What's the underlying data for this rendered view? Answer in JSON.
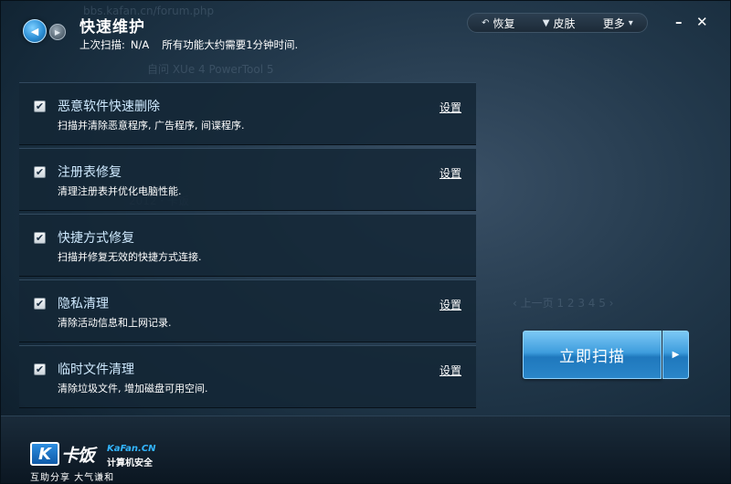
{
  "header": {
    "title": "快速维护",
    "last_scan_label": "上次扫描:",
    "last_scan_value": "N/A",
    "note": "所有功能大约需要1分钟时间."
  },
  "menu": {
    "restore": "恢复",
    "skin": "皮肤",
    "more": "更多"
  },
  "tasks": [
    {
      "title": "恶意软件快速删除",
      "desc": "扫描并清除恶意程序, 广告程序, 间谍程序.",
      "settings": "设置",
      "checked": true
    },
    {
      "title": "注册表修复",
      "desc": "清理注册表并优化电脑性能.",
      "settings": "设置",
      "checked": true
    },
    {
      "title": "快捷方式修复",
      "desc": "扫描并修复无效的快捷方式连接.",
      "settings": "",
      "checked": true
    },
    {
      "title": "隐私清理",
      "desc": "清除活动信息和上网记录.",
      "settings": "设置",
      "checked": true
    },
    {
      "title": "临时文件清理",
      "desc": "清除垃圾文件, 增加磁盘可用空间.",
      "settings": "设置",
      "checked": true
    }
  ],
  "scan_button": "立即扫描",
  "logo": {
    "main": "卡饭",
    "site": "KaFan.CN",
    "tag1": "计算机安全",
    "tag2": "互助分享   大气谦和"
  },
  "icons": {
    "back": "back-arrow-icon",
    "forward": "forward-arrow-icon",
    "restore": "undo-icon",
    "skin": "tshirt-icon",
    "more": "dropdown-triangle-icon",
    "minimize": "minimize-icon",
    "close": "close-icon",
    "checkbox": "checkmark-icon",
    "scan_dropdown": "play-triangle-icon"
  },
  "colors": {
    "accent": "#3e9ddd",
    "task_title": "#cfeaff",
    "panel_bg": "#142636"
  }
}
